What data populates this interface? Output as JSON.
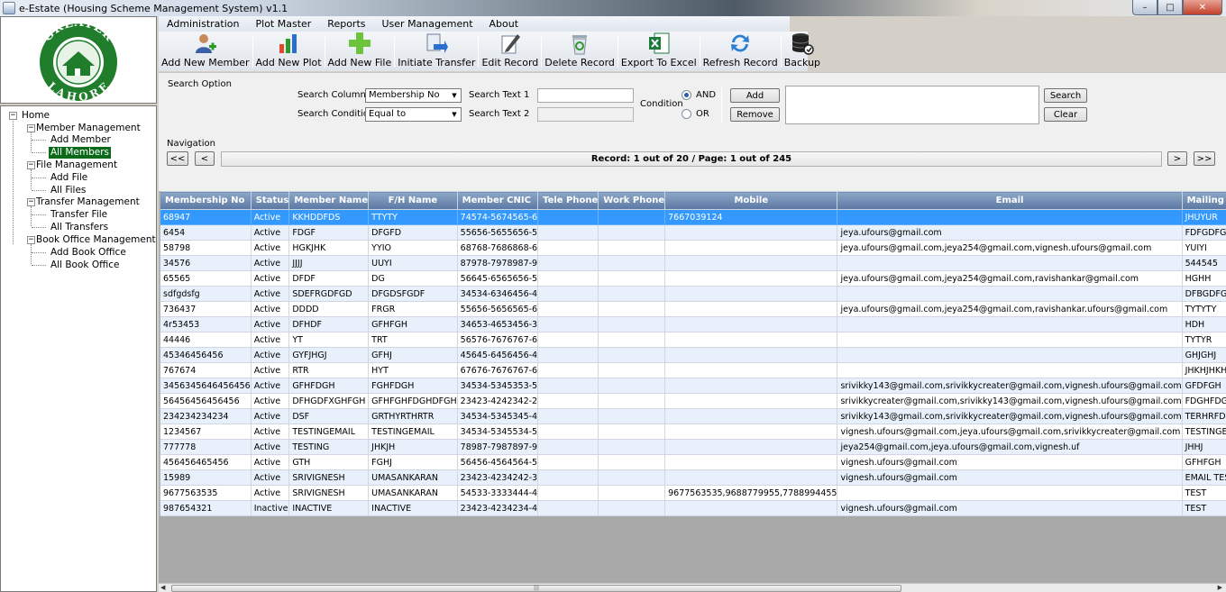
{
  "window": {
    "title": "e-Estate (Housing Scheme Management System) v1.1",
    "minimize": "–",
    "maximize": "□",
    "close": "✕"
  },
  "logo": {
    "top_text": "GREATER",
    "bottom_text": "LAHORE",
    "colors": {
      "ring": "#1f7d2b",
      "inner": "#ffffff"
    }
  },
  "menu": [
    "Administration",
    "Plot Master",
    "Reports",
    "User Management",
    "About"
  ],
  "toolbar": [
    {
      "label": "Add New Member",
      "icon": "add-member-icon"
    },
    {
      "label": "Add New Plot",
      "icon": "add-plot-icon"
    },
    {
      "label": "Add New File",
      "icon": "add-file-icon"
    },
    {
      "label": "Initiate Transfer",
      "icon": "transfer-icon"
    },
    {
      "label": "Edit Record",
      "icon": "edit-icon"
    },
    {
      "label": "Delete Record",
      "icon": "recycle-bin-icon"
    },
    {
      "label": "Export To Excel",
      "icon": "excel-icon"
    },
    {
      "label": "Refresh Record",
      "icon": "refresh-icon"
    },
    {
      "label": "Backup",
      "icon": "database-backup-icon"
    }
  ],
  "tree": {
    "home": "Home",
    "groups": [
      {
        "label": "Member Management",
        "children": [
          "Add Member",
          "All Members"
        ]
      },
      {
        "label": "File Management",
        "children": [
          "Add File",
          "All Files"
        ]
      },
      {
        "label": "Transfer Management",
        "children": [
          "Transfer File",
          "All Transfers"
        ]
      },
      {
        "label": "Book Office Management",
        "children": [
          "Add Book Office",
          "All Book Office"
        ]
      }
    ],
    "selected": "All Members"
  },
  "search": {
    "group_label": "Search Option",
    "column_label": "Search Column",
    "column_value": "Membership No",
    "condition_label": "Search Condition",
    "condition_value": "Equal to",
    "text1_label": "Search Text 1",
    "text1_value": "",
    "text2_label": "Search Text 2",
    "text2_value": "",
    "condition_group_label": "Condition",
    "and_label": "AND",
    "or_label": "OR",
    "and_selected": true,
    "add_label": "Add",
    "remove_label": "Remove",
    "search_label": "Search",
    "clear_label": "Clear"
  },
  "navigation": {
    "label": "Navigation",
    "first": "<<",
    "prev": "<",
    "next": ">",
    "last": ">>",
    "status": "Record: 1 out of 20 / Page: 1 out of 245"
  },
  "grid": {
    "columns": [
      "Membership No",
      "Status",
      "Member Name",
      "F/H Name",
      "Member CNIC",
      "Tele Phone",
      "Work Phone",
      "Mobile",
      "Email",
      "Mailing Addr"
    ],
    "rows": [
      [
        "68947",
        "Active",
        "KKHDDFDS",
        "TTYTY",
        "74574-5674565-6",
        "",
        "",
        "7667039124",
        "",
        "JHUYUR"
      ],
      [
        "6454",
        "Active",
        "FDGF",
        "DFGFD",
        "55656-5655656-5",
        "",
        "",
        "",
        "jeya.ufours@gmail.com",
        "FDFGDFGDF"
      ],
      [
        "58798",
        "Active",
        "HGKJHK",
        "YYIO",
        "68768-7686868-6",
        "",
        "",
        "",
        "jeya.ufours@gmail.com,jeya254@gmail.com,vignesh.ufours@gmail.com",
        "YUIYI"
      ],
      [
        "34576",
        "Active",
        "JJJJ",
        "UUYI",
        "87978-7978987-9",
        "",
        "",
        "",
        "",
        "544545"
      ],
      [
        "65565",
        "Active",
        "DFDF",
        "DG",
        "56645-6565656-5",
        "",
        "",
        "",
        "jeya.ufours@gmail.com,jeya254@gmail.com,ravishankar@gmail.com",
        "HGHH"
      ],
      [
        "sdfgdsfg",
        "Active",
        "SDEFRGDFGD",
        "DFGDSFGDF",
        "34534-6346456-4",
        "",
        "",
        "",
        "",
        "DFBGDFG"
      ],
      [
        "736437",
        "Active",
        "DDDD",
        "FRGR",
        "55656-5656565-6",
        "",
        "",
        "",
        "jeya.ufours@gmail.com,jeya254@gmail.com,ravishankar.ufours@gmail.com",
        "TYTYTY"
      ],
      [
        "4r53453",
        "Active",
        "DFHDF",
        "GFHFGH",
        "34653-4653456-3",
        "",
        "",
        "",
        "",
        "HDH"
      ],
      [
        "44446",
        "Active",
        "YT",
        "TRT",
        "56576-7676767-6",
        "",
        "",
        "",
        "",
        "TYTYR"
      ],
      [
        "45346456456",
        "Active",
        "GYFJHGJ",
        "GFHJ",
        "45645-6456456-4",
        "",
        "",
        "",
        "",
        "GHJGHJ"
      ],
      [
        "767674",
        "Active",
        "RTR",
        "HYT",
        "67676-7676767-6",
        "",
        "",
        "",
        "",
        "JHKHJHKH"
      ],
      [
        "3456345646456456",
        "Active",
        "GFHFDGH",
        "FGHFDGH",
        "34534-5345353-5",
        "",
        "",
        "",
        "srivikky143@gmail.com,srivikkycreater@gmail.com,vignesh.ufours@gmail.com",
        "GFDFGH"
      ],
      [
        "56456456456456",
        "Active",
        "DFHGDFXGHFGH",
        "GFHFGHFDGHDFGH",
        "23423-4242342-2",
        "",
        "",
        "",
        "srivikkycreater@gmail.com,srivikky143@gmail.com,vignesh.ufours@gmail.com",
        "FDGHFDGHFG"
      ],
      [
        "234234234234",
        "Active",
        "DSF",
        "GRTHYRTHRTR",
        "34534-5345345-4",
        "",
        "",
        "",
        "srivikky143@gmail.com,srivikkycreater@gmail.com,vignesh.ufours@gmail.com",
        "TERHRFDGTH"
      ],
      [
        "1234567",
        "Active",
        "TESTINGEMAIL",
        "TESTINGEMAIL",
        "34534-5345534-5",
        "",
        "",
        "",
        "vignesh.ufours@gmail.com,jeya.ufours@gmail.com,srivikkycreater@gmail.com",
        "TESTINGEMA"
      ],
      [
        "777778",
        "Active",
        "TESTING",
        "JHKJH",
        "78987-7987897-9",
        "",
        "",
        "",
        "jeya254@gmail.com,jeya.ufours@gmail.com,vignesh.uf",
        "JHHJ"
      ],
      [
        "456456465456",
        "Active",
        "GTH",
        "FGHJ",
        "56456-4564564-5",
        "",
        "",
        "",
        "vignesh.ufours@gmail.com",
        "GFHFGH"
      ],
      [
        "15989",
        "Active",
        "SRIVIGNESH",
        "UMASANKARAN",
        "23423-4234242-3",
        "",
        "",
        "",
        "vignesh.ufours@gmail.com",
        "EMAIL TESTIN"
      ],
      [
        "9677563535",
        "Active",
        "SRIVIGNESH",
        "UMASANKARAN",
        "54533-3333444-4",
        "",
        "",
        "9677563535,9688779955,7788994455",
        "",
        "TEST"
      ],
      [
        "987654321",
        "Inactive",
        "INACTIVE",
        "INACTIVE",
        "23423-4234234-4",
        "",
        "",
        "",
        "vignesh.ufours@gmail.com",
        "TEST"
      ]
    ],
    "selected_row": 0
  },
  "scrollbar": {
    "thumb_grip": "|||"
  }
}
